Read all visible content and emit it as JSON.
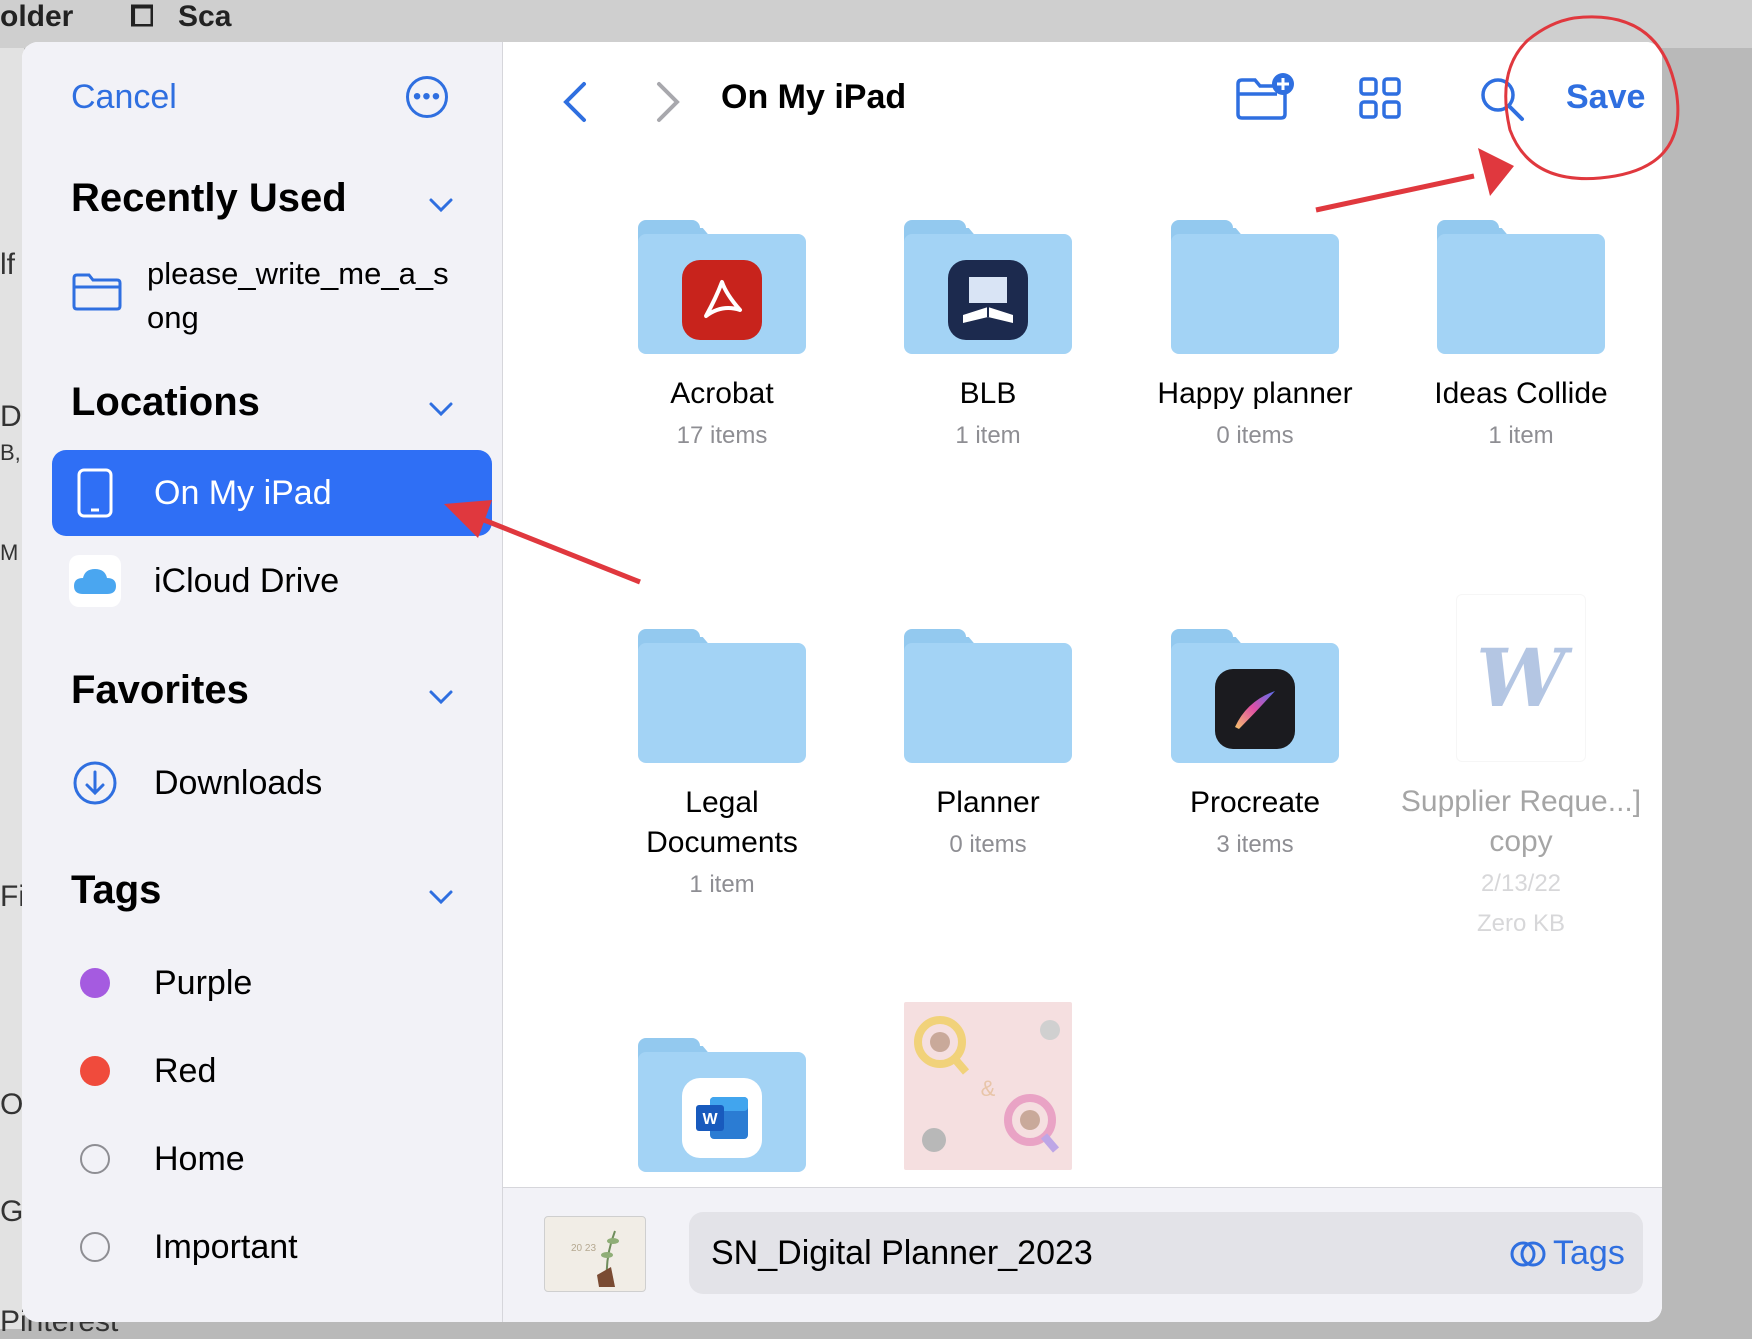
{
  "background": {
    "top_labels": [
      "older",
      "Sca"
    ],
    "left_fragments": [
      "lf",
      "Di",
      "B,",
      "M",
      "Fil",
      "Or",
      "Go"
    ],
    "bottom_fragment": "Pinterest"
  },
  "sidebar": {
    "cancel_label": "Cancel",
    "recently_used": {
      "title": "Recently Used",
      "items": [
        {
          "label": "please_write_me_a_song"
        }
      ]
    },
    "locations": {
      "title": "Locations",
      "items": [
        {
          "label": "On My iPad",
          "selected": true
        },
        {
          "label": "iCloud Drive",
          "selected": false
        }
      ]
    },
    "favorites": {
      "title": "Favorites",
      "items": [
        {
          "label": "Downloads"
        }
      ]
    },
    "tags": {
      "title": "Tags",
      "items": [
        {
          "label": "Purple",
          "color": "#a55be0"
        },
        {
          "label": "Red",
          "color": "#f04b3c"
        },
        {
          "label": "Home",
          "color": ""
        },
        {
          "label": "Important",
          "color": ""
        }
      ]
    }
  },
  "toolbar": {
    "title": "On My iPad",
    "save_label": "Save"
  },
  "grid": {
    "items": [
      {
        "name": "Acrobat",
        "sub": "17 items",
        "icon": "acrobat-icon"
      },
      {
        "name": "BLB",
        "sub": "1 item",
        "icon": "blb-icon"
      },
      {
        "name": "Happy planner",
        "sub": "0 items"
      },
      {
        "name": "Ideas Collide",
        "sub": "1 item"
      },
      {
        "name": "Legal Documents",
        "sub": "1 item"
      },
      {
        "name": "Planner",
        "sub": "0 items"
      },
      {
        "name": "Procreate",
        "sub": "3 items",
        "icon": "procreate-icon"
      },
      {
        "name": "Supplier Reque...] copy",
        "sub": "2/13/22",
        "sub2": "Zero KB",
        "icon": "word-doc-icon"
      },
      {
        "name": "",
        "sub": "",
        "icon": "word-icon"
      },
      {
        "name": "",
        "sub": "",
        "icon": "image-thumbnail"
      }
    ]
  },
  "bottom": {
    "filename": "SN_Digital Planner_2023",
    "tags_label": "Tags",
    "thumb_text": "20 23"
  },
  "colors": {
    "accent": "#2f6fe0",
    "selected_bg": "#2f6ff5",
    "folder": "#a3d3f5",
    "annotation": "#e0383e"
  }
}
